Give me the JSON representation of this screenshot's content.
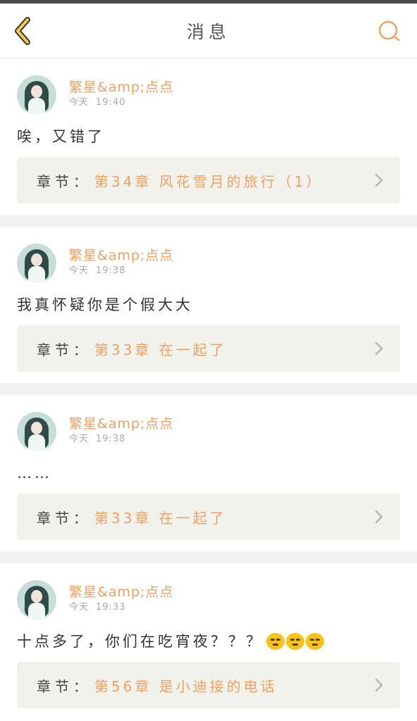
{
  "header": {
    "title": "消息",
    "back_icon": "chevron-left-icon",
    "search_icon": "search-icon",
    "colors": {
      "back": "#f5c74a",
      "search": "#f0a060"
    }
  },
  "messages": [
    {
      "username": "繁星&amp;点点",
      "date": "今天",
      "time": "19:40",
      "content": "唉，又错了",
      "chapter_label": "章节：",
      "chapter_title": "第34章 风花雪月的旅行（1）",
      "emojis": []
    },
    {
      "username": "繁星&amp;点点",
      "date": "今天",
      "time": "19:38",
      "content": "我真怀疑你是个假大大",
      "chapter_label": "章节：",
      "chapter_title": "第33章 在一起了",
      "emojis": []
    },
    {
      "username": "繁星&amp;点点",
      "date": "今天",
      "time": "19:38",
      "content": "……",
      "chapter_label": "章节：",
      "chapter_title": "第33章 在一起了",
      "emojis": []
    },
    {
      "username": "繁星&amp;点点",
      "date": "今天",
      "time": "19:33",
      "content": "十点多了，你们在吃宵夜？？？",
      "chapter_label": "章节：",
      "chapter_title": "第56章 是小迪接的电话",
      "emojis": [
        "awkward-face-emoji",
        "awkward-face-emoji",
        "awkward-face-emoji"
      ]
    }
  ]
}
